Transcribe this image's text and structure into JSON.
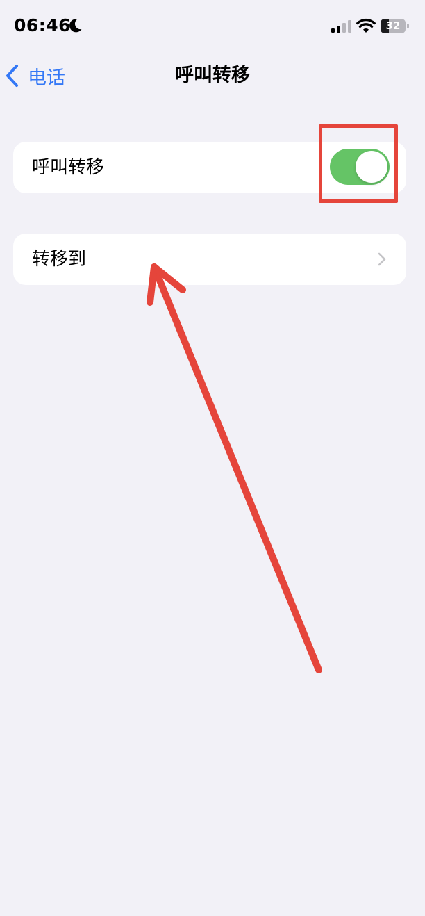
{
  "status_bar": {
    "time": "06:46",
    "battery_level": "32",
    "battery_fraction": 0.32
  },
  "nav": {
    "back_label": "电话",
    "title": "呼叫转移"
  },
  "settings": {
    "call_forwarding": {
      "label": "呼叫转移",
      "enabled": true
    },
    "forward_to": {
      "label": "转移到"
    }
  },
  "colors": {
    "accent": "#3478f6",
    "toggle_on": "#65c466",
    "background": "#f2f1f7",
    "annotation": "#e5453b"
  },
  "icons": {
    "moon": "moon-icon",
    "signal": "cellular-signal-icon",
    "wifi": "wifi-icon",
    "battery": "battery-icon",
    "back": "chevron-left-icon",
    "disclosure": "chevron-right-icon"
  }
}
